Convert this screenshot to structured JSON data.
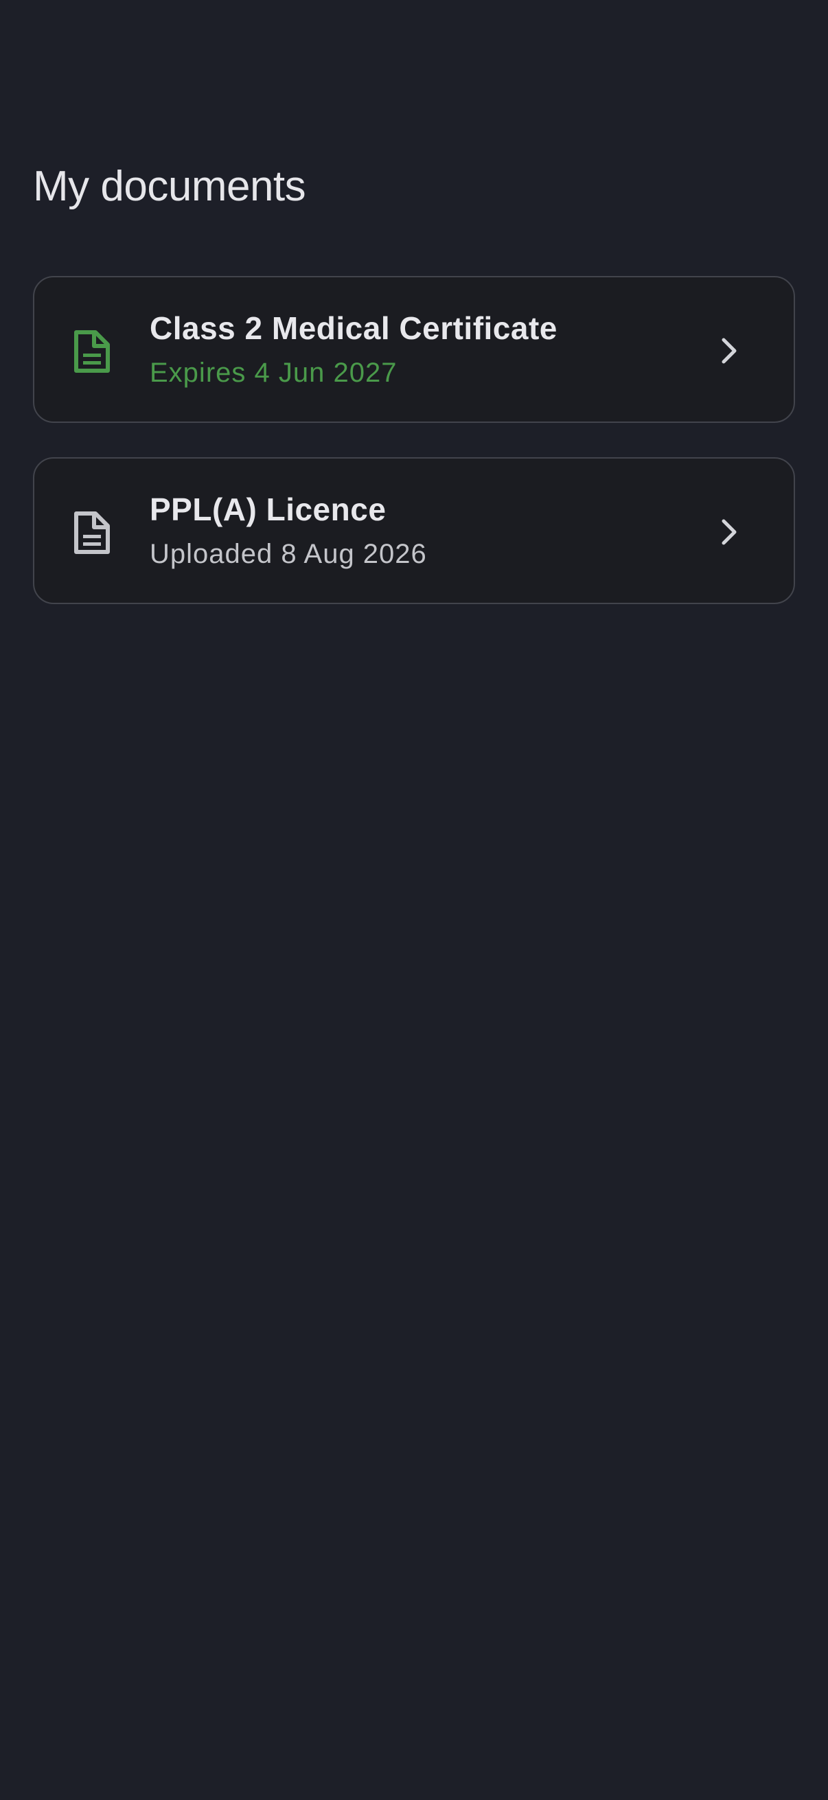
{
  "page": {
    "title": "My documents"
  },
  "colors": {
    "background": "#1d1f28",
    "card_background": "#1b1c21",
    "card_border": "#42444c",
    "accent_green": "#4a9a4a",
    "muted_text": "#c4c5ca"
  },
  "documents": [
    {
      "title": "Class 2 Medical Certificate",
      "subtitle": "Expires 4 Jun 2027",
      "icon": "document-icon",
      "status": "valid",
      "status_color": "#4a9a4a"
    },
    {
      "title": "PPL(A) Licence",
      "subtitle": "Uploaded 8 Aug 2026",
      "icon": "document-icon",
      "status": "neutral",
      "status_color": "#c4c5ca"
    }
  ]
}
